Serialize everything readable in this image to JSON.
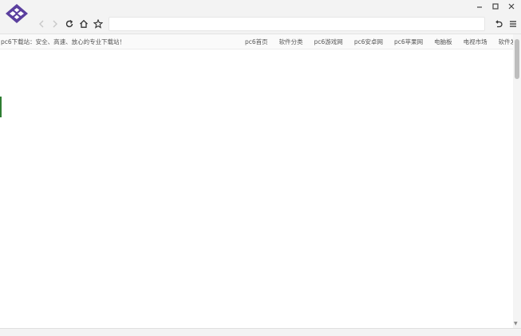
{
  "browser": {
    "address_value": "",
    "buttons": {
      "back": "back-icon",
      "forward": "forward-icon",
      "reload": "reload-icon",
      "home": "home-icon",
      "bookmark": "star-icon",
      "undo": "undo-icon",
      "menu": "menu-icon"
    },
    "colors": {
      "chrome": "#f3f3f3",
      "logo": "#5b3f9e"
    }
  },
  "site": {
    "tagline": "pc6下载站：安全、高速、放心的专业下载站！",
    "nav": [
      "pc6首页",
      "软件分类",
      "pc6游戏网",
      "pc6安卓网",
      "pc6苹果网",
      "电脑板",
      "电视市场",
      "软件发布"
    ]
  }
}
